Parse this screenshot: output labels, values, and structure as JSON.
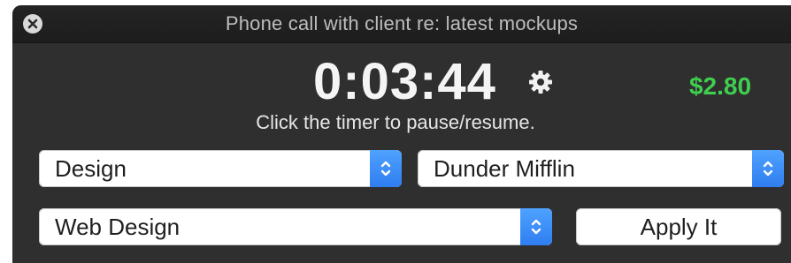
{
  "window": {
    "title": "Phone call with client re: latest mockups"
  },
  "timer": {
    "elapsed": "0:03:44",
    "hint": "Click the timer to pause/resume.",
    "amount": "$2.80",
    "amount_color": "#3fcf4f"
  },
  "selects": {
    "category": {
      "value": "Design"
    },
    "client": {
      "value": "Dunder Mifflin"
    },
    "project": {
      "value": "Web Design"
    }
  },
  "actions": {
    "apply_label": "Apply It"
  },
  "icons": {
    "close": "close-icon",
    "settings": "gear-icon",
    "stepper": "chevron-up-down-icon"
  },
  "colors": {
    "window_bg": "#2f2f2f",
    "titlebar_bg": "#1f1f1f",
    "accent": "#2f7df0"
  }
}
